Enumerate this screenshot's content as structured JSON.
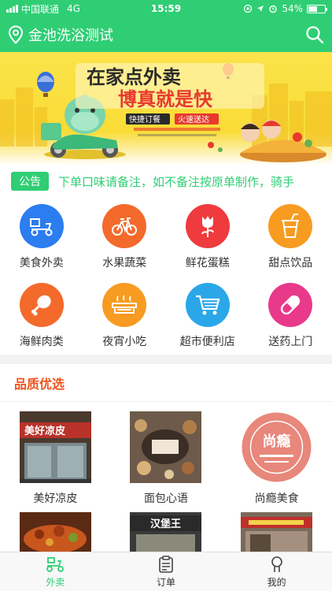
{
  "status_bar": {
    "carrier": "中国联通",
    "network": "4G",
    "time": "15:59",
    "battery": "54%",
    "battery_level": 0.54
  },
  "header": {
    "location_title": "金池洗浴测试",
    "icons": [
      "location-pin-icon",
      "search-icon"
    ]
  },
  "banner": {
    "headline_1": "在家点外卖",
    "headline_2": "博真就是快",
    "tags": [
      "快捷订餐",
      "火速送达"
    ]
  },
  "notice": {
    "tag": "公告",
    "text": "下单口味请备注，如不备注按原单制作，骑手"
  },
  "categories": [
    {
      "label": "美食外卖",
      "icon": "scooter-icon",
      "color": "#2b7df0"
    },
    {
      "label": "水果蔬菜",
      "icon": "bicycle-icon",
      "color": "#f36a2b"
    },
    {
      "label": "鲜花蛋糕",
      "icon": "rose-icon",
      "color": "#ef3a3e"
    },
    {
      "label": "甜点饮品",
      "icon": "drink-cup-icon",
      "color": "#f79b21"
    },
    {
      "label": "海鲜肉类",
      "icon": "drumstick-icon",
      "color": "#f36a2b"
    },
    {
      "label": "夜宵小吃",
      "icon": "grill-icon",
      "color": "#f79b21"
    },
    {
      "label": "超市便利店",
      "icon": "cart-icon",
      "color": "#2aa7e8"
    },
    {
      "label": "送药上门",
      "icon": "pill-icon",
      "color": "#e8398b"
    }
  ],
  "featured": {
    "title": "品质优选",
    "shops": [
      {
        "name": "美好凉皮",
        "sign": "美好凉皮"
      },
      {
        "name": "面包心语",
        "sign": ""
      },
      {
        "name": "尚瘾美食",
        "sign": "尚瘾"
      },
      {
        "name": "",
        "sign": ""
      },
      {
        "name": "",
        "sign": "汉堡王"
      },
      {
        "name": "",
        "sign": ""
      }
    ]
  },
  "tabbar": {
    "tabs": [
      {
        "label": "外卖",
        "icon": "bike-icon",
        "active": true
      },
      {
        "label": "订单",
        "icon": "clipboard-icon",
        "active": false
      },
      {
        "label": "我的",
        "icon": "person-icon",
        "active": false
      }
    ]
  },
  "colors": {
    "primary": "#2fce74",
    "section_title": "#f0531c",
    "banner_yellow": "#f9dc36"
  }
}
